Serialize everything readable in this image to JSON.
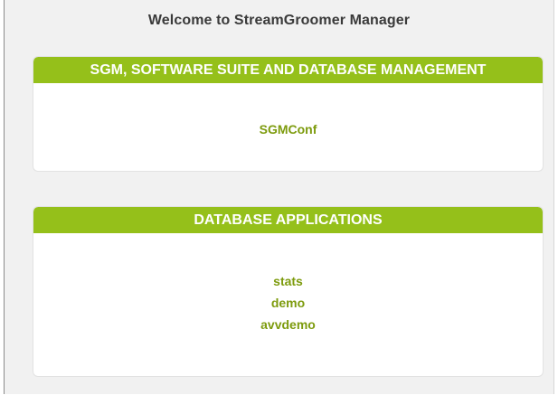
{
  "page": {
    "title": "Welcome to StreamGroomer Manager"
  },
  "sgm_panel": {
    "header": "SGM, SOFTWARE SUITE AND DATABASE MANAGEMENT",
    "links": [
      "SGMConf"
    ]
  },
  "db_panel": {
    "header": "DATABASE APPLICATIONS",
    "links": [
      "stats",
      "demo",
      "avvdemo"
    ]
  },
  "colors": {
    "accent_green": "#95c01a",
    "link_green": "#7d9b0d",
    "background": "#f1f1f1"
  }
}
